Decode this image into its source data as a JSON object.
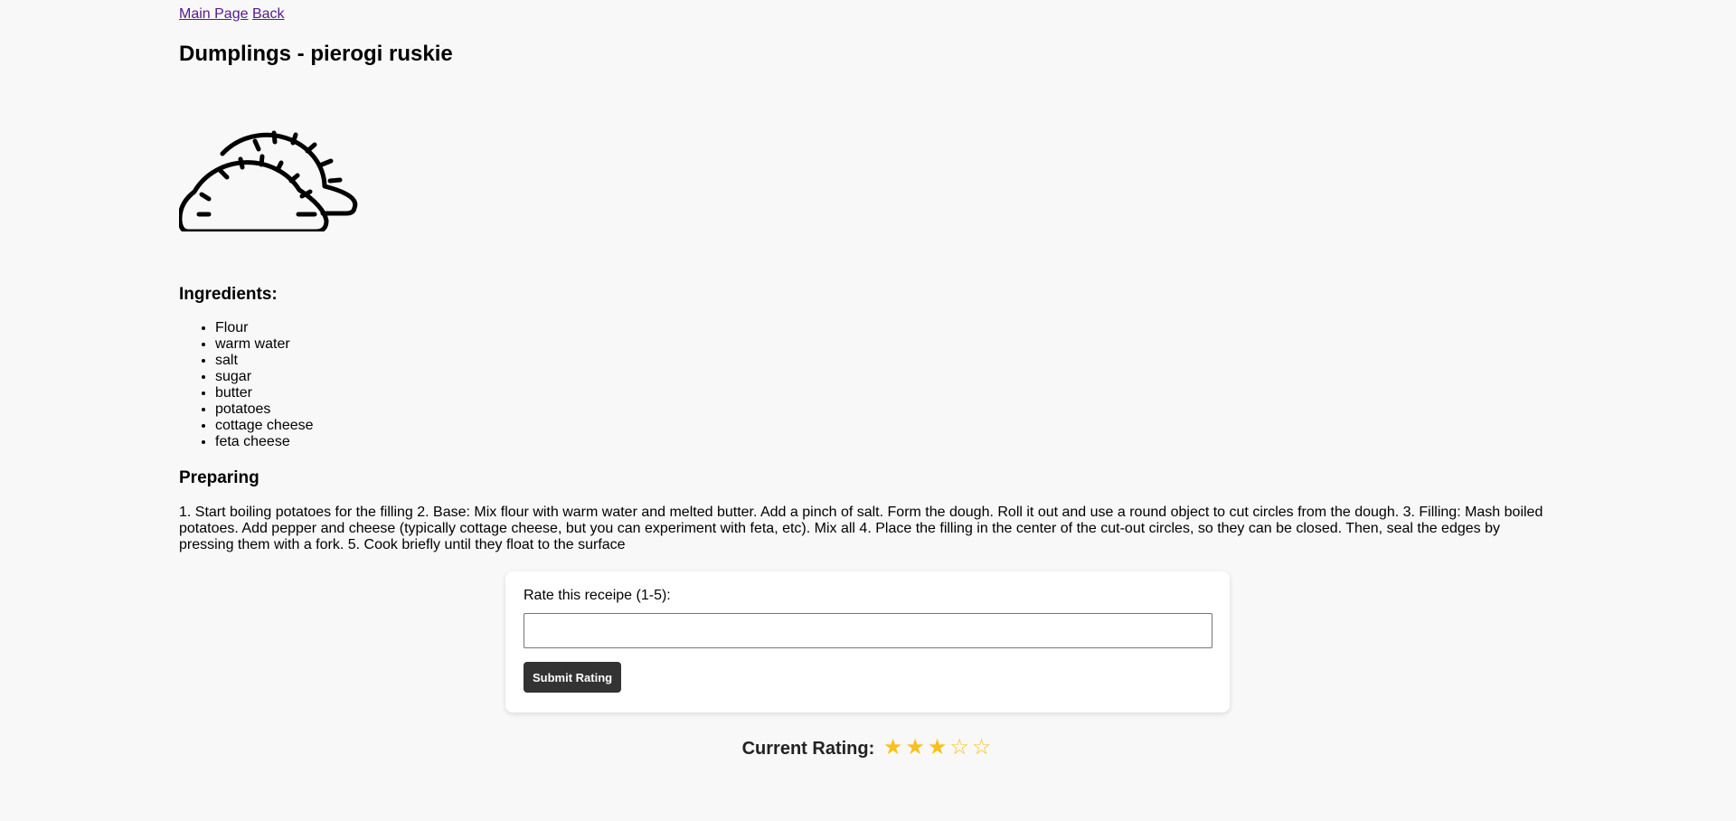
{
  "nav": {
    "main_page": "Main Page",
    "back": "Back"
  },
  "recipe": {
    "title": "Dumplings - pierogi ruskie",
    "image_icon": "dumplings-icon",
    "ingredients_heading": "Ingredients:",
    "ingredients": [
      "Flour",
      "warm water",
      "salt",
      "sugar",
      "butter",
      "potatoes",
      "cottage cheese",
      "feta cheese"
    ],
    "preparing_heading": "Preparing",
    "steps": "1. Start boiling potatoes for the filling 2. Base: Mix flour with warm water and melted butter. Add a pinch of salt. Form the dough. Roll it out and use a round object to cut circles from the dough. 3. Filling: Mash boiled potatoes. Add pepper and cheese (typically cottage cheese, but you can experiment with feta, etc). Mix all 4. Place the filling in the center of the cut-out circles, so they can be closed. Then, seal the edges by pressing them with a fork. 5. Cook briefly until they float to the surface"
  },
  "rating_form": {
    "label": "Rate this receipe (1-5):",
    "input_value": "",
    "submit_label": "Submit Rating"
  },
  "current_rating": {
    "label": "Current Rating:",
    "stars_display": "★★★☆☆",
    "value": 3,
    "max": 5,
    "star_color": "#f7c01e"
  }
}
